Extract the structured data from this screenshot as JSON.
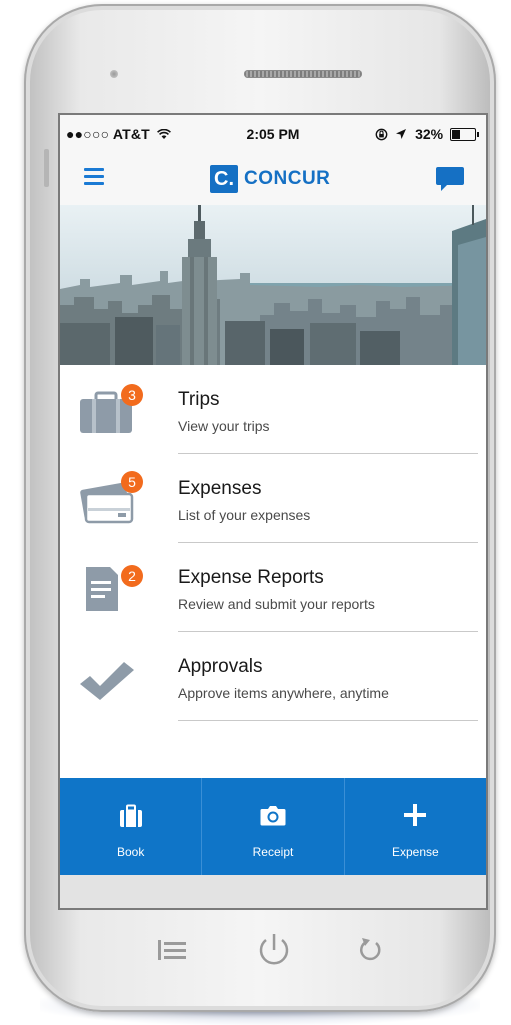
{
  "status_bar": {
    "carrier": "●●○○○ AT&T",
    "time": "2:05 PM",
    "battery": "32%"
  },
  "navbar": {
    "logo_letter": "C.",
    "logo_text": "CONCUR",
    "menu_icon": "hamburger-icon",
    "chat_icon": "chat-bubble-icon"
  },
  "menu": [
    {
      "title": "Trips",
      "subtitle": "View your trips",
      "badge": "3",
      "icon": "briefcase-icon"
    },
    {
      "title": "Expenses",
      "subtitle": "List of your expenses",
      "badge": "5",
      "icon": "credit-card-icon"
    },
    {
      "title": "Expense Reports",
      "subtitle": "Review and submit your reports",
      "badge": "2",
      "icon": "report-icon"
    },
    {
      "title": "Approvals",
      "subtitle": "Approve items anywhere, anytime",
      "icon": "checkmark-icon"
    }
  ],
  "tabbar": [
    {
      "label": "Book",
      "icon": "briefcase-icon"
    },
    {
      "label": "Receipt",
      "icon": "camera-icon"
    },
    {
      "label": "Expense",
      "icon": "plus-icon"
    }
  ],
  "colors": {
    "brand_blue": "#1570c4",
    "tab_blue": "#0f75c8",
    "badge_orange": "#f26b1d",
    "icon_gray": "#8e9ba8"
  }
}
